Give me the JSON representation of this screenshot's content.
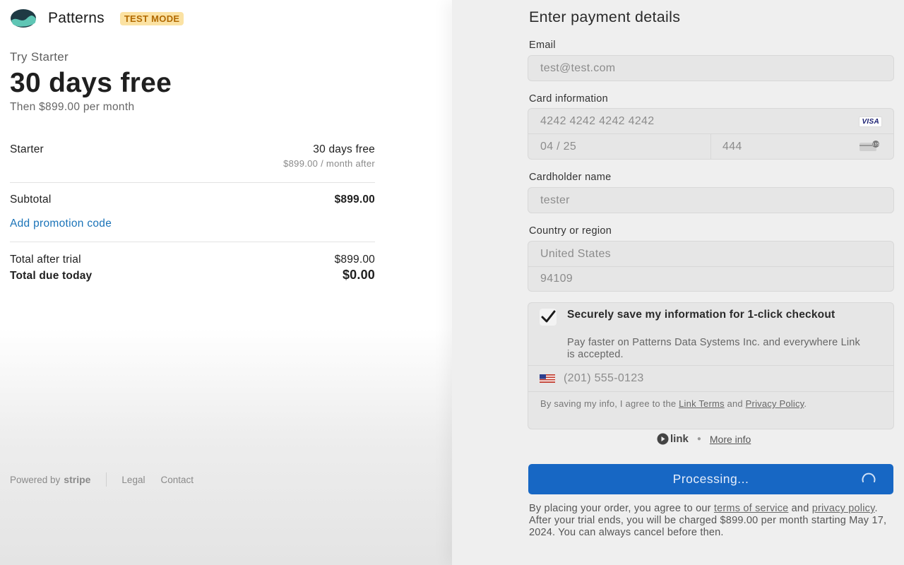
{
  "brand": {
    "name": "Patterns",
    "badge": "TEST MODE"
  },
  "plan": {
    "try_label": "Try Starter",
    "headline": "30 days free",
    "then_text": "Then $899.00 per month"
  },
  "summary": {
    "item_name": "Starter",
    "item_value": "30 days free",
    "item_sub": "$899.00 / month after",
    "subtotal_label": "Subtotal",
    "subtotal_value": "$899.00",
    "promo_link": "Add promotion code",
    "after_trial_label": "Total after trial",
    "after_trial_value": "$899.00",
    "due_today_label": "Total due today",
    "due_today_value": "$0.00"
  },
  "footer": {
    "powered_by": "Powered by",
    "stripe": "stripe",
    "legal": "Legal",
    "contact": "Contact"
  },
  "form": {
    "title": "Enter payment details",
    "email_label": "Email",
    "email_value": "test@test.com",
    "card_label": "Card information",
    "card_number": "4242 4242 4242 4242",
    "card_brand": "VISA",
    "card_expiry": "04 / 25",
    "card_cvc": "444",
    "cardholder_label": "Cardholder name",
    "cardholder_value": "tester",
    "country_label": "Country or region",
    "country_value": "United States",
    "zip_value": "94109"
  },
  "link": {
    "save_title": "Securely save my information for 1-click checkout",
    "save_desc": "Pay faster on Patterns Data Systems Inc. and everywhere Link is accepted.",
    "phone": "(201) 555-0123",
    "agree_prefix": "By saving my info, I agree to the ",
    "link_terms": "Link Terms",
    "and": " and ",
    "privacy": "Privacy Policy",
    "period": ".",
    "brand": "link",
    "more_info": "More info"
  },
  "submit": {
    "label": "Processing..."
  },
  "terms": {
    "prefix": "By placing your order, you agree to our ",
    "tos": "terms of service",
    "and": " and ",
    "privacy": "privacy policy",
    "period": ".",
    "trial_note": "After your trial ends, you will be charged $899.00 per month starting May 17, 2024. You can always cancel before then."
  },
  "colors": {
    "primary": "#1767c4",
    "link_blue": "#1a73b8",
    "badge_bg": "#fbe2a3",
    "badge_text": "#b26a00"
  }
}
